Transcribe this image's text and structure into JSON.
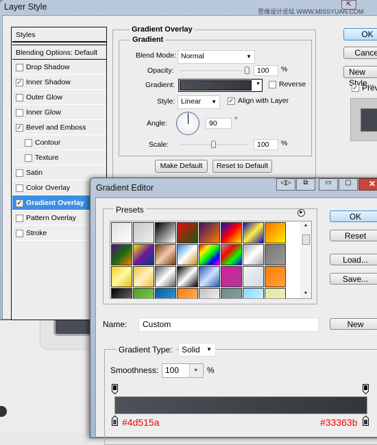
{
  "layer_style": {
    "title": "Layer Style",
    "watermark": "思缘设计论坛 WWW.MISSYUAN.COM",
    "styles_header": "Styles",
    "blending_options": "Blending Options: Default",
    "items": [
      {
        "label": "Drop Shadow",
        "checked": false,
        "indent": false
      },
      {
        "label": "Inner Shadow",
        "checked": true,
        "indent": false
      },
      {
        "label": "Outer Glow",
        "checked": false,
        "indent": false
      },
      {
        "label": "Inner Glow",
        "checked": false,
        "indent": false
      },
      {
        "label": "Bevel and Emboss",
        "checked": true,
        "indent": false
      },
      {
        "label": "Contour",
        "checked": false,
        "indent": true
      },
      {
        "label": "Texture",
        "checked": false,
        "indent": true
      },
      {
        "label": "Satin",
        "checked": false,
        "indent": false
      },
      {
        "label": "Color Overlay",
        "checked": false,
        "indent": false
      },
      {
        "label": "Gradient Overlay",
        "checked": true,
        "indent": false,
        "selected": true
      },
      {
        "label": "Pattern Overlay",
        "checked": false,
        "indent": false
      },
      {
        "label": "Stroke",
        "checked": false,
        "indent": false
      }
    ],
    "section_title": "Gradient Overlay",
    "group_title": "Gradient",
    "blend_mode_label": "Blend Mode:",
    "blend_mode": "Normal",
    "opacity_label": "Opacity:",
    "opacity": "100",
    "opacity_unit": "%",
    "gradient_label": "Gradient:",
    "reverse_label": "Reverse",
    "reverse_checked": false,
    "style_label": "Style:",
    "style": "Linear",
    "align_label": "Align with Layer",
    "align_checked": true,
    "angle_label": "Angle:",
    "angle": "90",
    "angle_unit": "°",
    "scale_label": "Scale:",
    "scale": "100",
    "scale_unit": "%",
    "make_default": "Make Default",
    "reset_default": "Reset to Default",
    "ok": "OK",
    "cancel": "Cancel",
    "new_style": "New Style...",
    "preview_label": "Preview",
    "preview_checked": true
  },
  "gradient_editor": {
    "title": "Gradient Editor",
    "presets_label": "Presets",
    "presets": [
      [
        "#e0e0e0",
        "#ffffff"
      ],
      [
        "#c8c8c8",
        "#eeeeee"
      ],
      [
        "#000000",
        "#ffffff"
      ],
      [
        "#e01010",
        "#1a5a12"
      ],
      [
        "#3a1466",
        "#ff7a00"
      ],
      [
        "#1010c0",
        "#ff0000",
        "#ffee00"
      ],
      [
        "#1010b0",
        "#ffee40",
        "#1010b0"
      ],
      [
        "#ff6a00",
        "#ffee00"
      ],
      [
        "#5a1080",
        "#1a6a10",
        "#ff7a00"
      ],
      [
        "#ffe000",
        "#6a1a9a",
        "#103a8a"
      ],
      [
        "#7a3a10",
        "#f0c8b0",
        "#7a3a10"
      ],
      [
        "#2a88d8",
        "#ffffff",
        "#c08a10"
      ],
      [
        "#ff0000",
        "#ffee00",
        "#00ff00",
        "#0000ff",
        "#ff00ff"
      ],
      [
        "#999999",
        "#ff0000",
        "#00ff00",
        "#0000ff"
      ],
      [
        "#aaaaaa",
        "#ffffff",
        "#aaaaaa"
      ],
      [
        "#777777",
        "#999999"
      ],
      [
        "#f0d020",
        "#fff8a0",
        "#e8c010"
      ],
      [
        "#f0c040",
        "#fff0c0",
        "#f0c040"
      ],
      [
        "#606060",
        "#ffffff",
        "#606060"
      ],
      [
        "#000000",
        "#ffffff",
        "#000000"
      ],
      [
        "#2a5ab0",
        "#d0e0ff",
        "#2a5ab0"
      ],
      [
        "#d020a0",
        "#b03a90"
      ],
      [
        "#f4f4f4",
        "#d0d8e0"
      ],
      [
        "#ff7a00",
        "#ffa040"
      ],
      [
        "#000000",
        "#888888"
      ],
      [
        "#4aa020",
        "#90d060"
      ],
      [
        "#0060a0",
        "#40a0e0"
      ],
      [
        "#ff7a00",
        "#ffc080"
      ],
      [
        "#c0c0c0",
        "#ffffff"
      ],
      [
        "#6a8a88",
        "#90a8a8"
      ],
      [
        "#80d8ff",
        "#e0f8ff"
      ],
      [
        "#e0e8a0",
        "#f0f0c0"
      ]
    ],
    "ok": "OK",
    "reset": "Reset",
    "load": "Load...",
    "save": "Save...",
    "name_label": "Name:",
    "name": "Custom",
    "new": "New",
    "gradient_type_label": "Gradient Type:",
    "gradient_type": "Solid",
    "smoothness_label": "Smoothness:",
    "smoothness": "100",
    "smoothness_unit": "%",
    "stop_left_color": "#4d515a",
    "stop_right_color": "#33363b",
    "stop_left_label": "#4d515a",
    "stop_right_label": "#33363b",
    "annotation_color": "#ff0000"
  }
}
